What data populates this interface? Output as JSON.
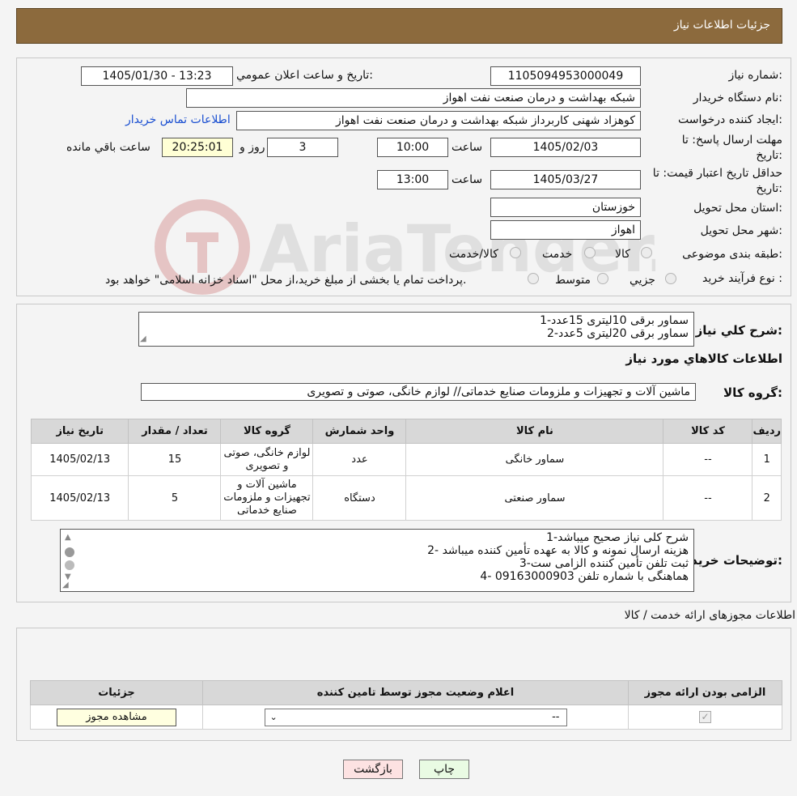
{
  "header": {
    "title": "جزئیات اطلاعات نیاز"
  },
  "watermark_text": "AriaTender.neT",
  "fields": {
    "need_number_label": "شماره نیاز:",
    "need_number": "1105094953000049",
    "announce_label": "تاریخ و ساعت اعلان عمومي:",
    "announce_value": "1405/01/30 - 13:23",
    "buyer_org_label": "نام دستگاه خريدار:",
    "buyer_org": "شبکه بهداشت و درمان صنعت نفت اهواز",
    "creator_label": "ايجاد کننده درخواست:",
    "creator": "کوهزاد شهنی کاربرداز شبکه بهداشت و درمان صنعت نفت اهواز",
    "contact_link": "اطلاعات تماس خريدار",
    "reply_deadline_label": "مهلت ارسال پاسخ: تا تاريخ:",
    "reply_date": "1405/02/03",
    "time_label": "ساعت",
    "reply_time": "10:00",
    "days_value": "3",
    "days_label": "روز و",
    "remaining_time": "20:25:01",
    "remaining_label": "ساعت باقي مانده",
    "validity_label": "حداقل تاريخ اعتبار قيمت: تا تاريخ:",
    "validity_date": "1405/03/27",
    "validity_time": "13:00",
    "province_label": "استان محل تحويل:",
    "province": "خوزستان",
    "city_label": "شهر محل تحويل:",
    "city": "اهواز",
    "category_label": "طبقه بندی موضوعی:",
    "category_options": [
      "کالا",
      "خدمت",
      "کالا/خدمت"
    ],
    "process_label": "نوع فرآيند خريد :",
    "process_options": [
      "جزيي",
      "متوسط"
    ],
    "process_note": "پرداخت تمام يا بخشی از مبلغ خريد،از محل \"اسناد خزانه اسلامی\" خواهد بود."
  },
  "description": {
    "label": "شرح كلي نياز:",
    "lines": [
      "1-سماور برقی 10لیتری 15عدد",
      "2-سماور برقی 20لیتری 5عدد"
    ]
  },
  "goods": {
    "section_title": "اطلاعات کالاهاي مورد نياز",
    "group_label": "گروه کالا:",
    "group_value": "ماشین آلات و تجهیزات و ملزومات صنایع خدماتی// لوازم خانگی، صوتی و تصویری",
    "columns": [
      "رديف",
      "کد کالا",
      "نام کالا",
      "واحد شمارش",
      "گروه کالا",
      "تعداد / مقدار",
      "تاريخ نياز"
    ],
    "rows": [
      {
        "idx": "1",
        "code": "--",
        "name": "سماور خانگی",
        "unit": "عدد",
        "group": "لوازم خانگی، صوتی و تصویری",
        "qty": "15",
        "date": "1405/02/13"
      },
      {
        "idx": "2",
        "code": "--",
        "name": "سماور صنعتی",
        "unit": "دستگاه",
        "group": "ماشین آلات و تجهیزات و ملزومات صنایع خدماتی",
        "qty": "5",
        "date": "1405/02/13"
      }
    ]
  },
  "buyer_notes": {
    "label": "توضيحات خريدار:",
    "lines": [
      "1-شرح کلی نیاز صحیح میباشد",
      "2- هزینه ارسال نمونه و کالا به عهده تأمین کننده میباشد",
      "3-ثبت تلفن تأمین کننده الزامی ست",
      "4- هماهنگی با شماره تلفن 09163000903"
    ]
  },
  "permits": {
    "section_title": "اطلاعات مجوزهای ارائه خدمت / کالا",
    "columns": [
      "الزامی بودن ارائه مجوز",
      "اعلام وضعيت مجوز توسط تامين کننده",
      "جزئيات"
    ],
    "select_value": "--",
    "view_button": "مشاهده مجوز"
  },
  "buttons": {
    "print": "چاپ",
    "back": "بازگشت"
  },
  "colors": {
    "header_bg": "#8c6a3d",
    "link": "#1a4fd1",
    "print_bg": "#e9fbe3",
    "back_bg": "#fde2e2"
  }
}
